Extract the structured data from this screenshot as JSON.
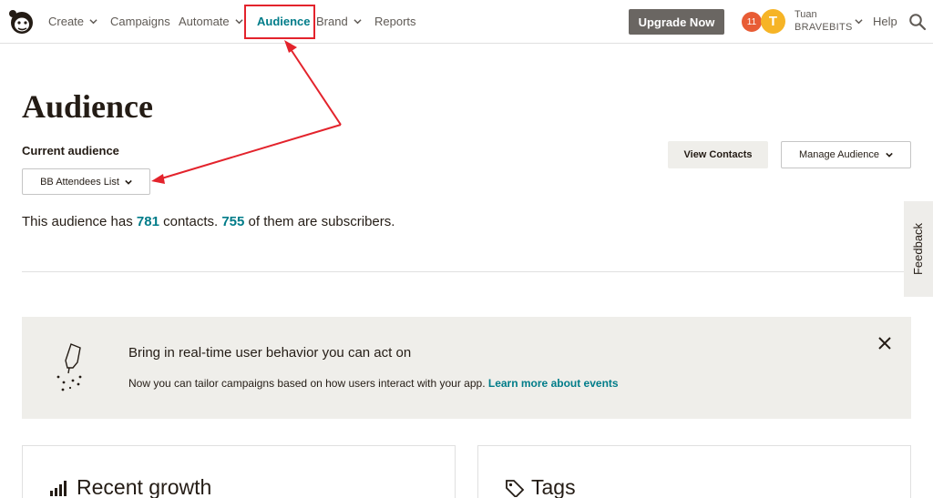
{
  "nav": {
    "items": [
      {
        "label": "Create",
        "has_dropdown": true
      },
      {
        "label": "Campaigns",
        "has_dropdown": false
      },
      {
        "label": "Automate",
        "has_dropdown": true
      },
      {
        "label": "Audience",
        "has_dropdown": false,
        "active": true
      },
      {
        "label": "Brand",
        "has_dropdown": true
      },
      {
        "label": "Reports",
        "has_dropdown": false
      }
    ],
    "upgrade_label": "Upgrade Now",
    "notification_count": "11",
    "avatar_initial": "T",
    "user_name": "Tuan",
    "account_name": "BRAVEBITS",
    "help_label": "Help",
    "logo_icon": "mailchimp-logo-icon",
    "search_icon": "search-icon"
  },
  "page": {
    "title": "Audience",
    "current_audience_label": "Current audience",
    "audience_selected": "BB Attendees List",
    "view_contacts_label": "View Contacts",
    "manage_audience_label": "Manage Audience",
    "summary_prefix": "This audience has ",
    "contacts_count": "781",
    "summary_mid": " contacts. ",
    "subscribers_count": "755",
    "summary_suffix": " of them are subscribers."
  },
  "feedback_label": "Feedback",
  "banner": {
    "title": "Bring in real-time user behavior you can act on",
    "text": "Now you can tailor campaigns based on how users interact with your app. ",
    "link": "Learn more about events",
    "icon": "pointing-hand-icon"
  },
  "cards": [
    {
      "title": "Recent growth",
      "icon": "bar-chart-icon"
    },
    {
      "title": "Tags",
      "icon": "tag-icon"
    }
  ],
  "colors": {
    "accent": "#007c89",
    "annotation": "#e3232c",
    "upgrade_button": "#6a6662",
    "notification": "#e85c35",
    "avatar": "#f6b426",
    "banner_bg": "#efeeea"
  }
}
